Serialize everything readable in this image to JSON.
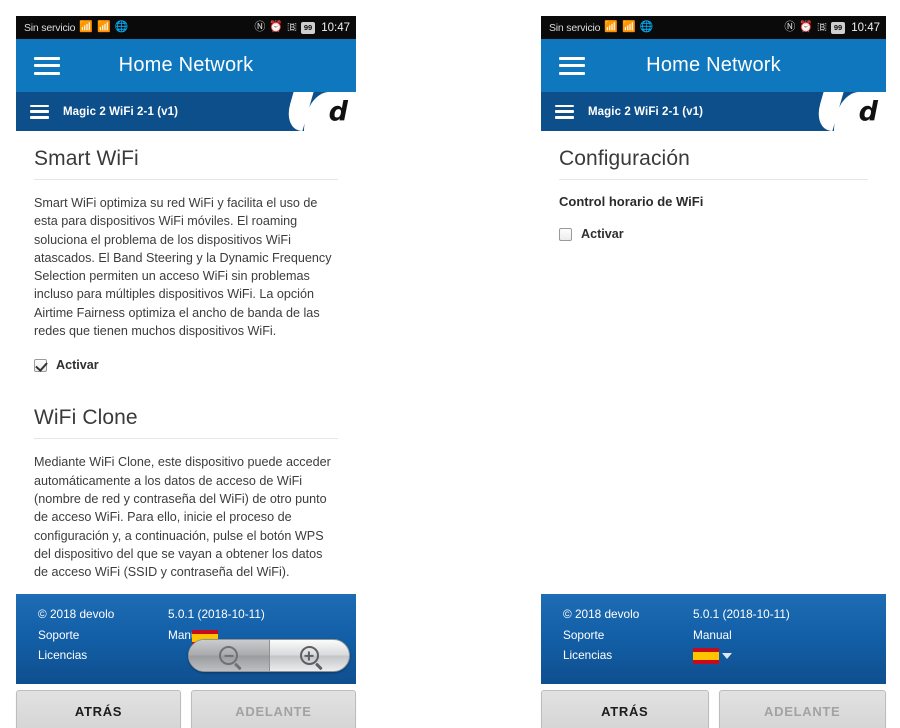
{
  "statusbar": {
    "carrier": "Sin servicio",
    "signal_icon": "signal-bars-icon",
    "wifi_icon": "wifi-icon",
    "data_icon": "globe-data-icon",
    "nfc_icon": "nfc-icon",
    "alarm_icon": "alarm-clock-icon",
    "bluetooth_icon": "bluetooth-icon",
    "battery_level": "99",
    "time": "10:47"
  },
  "header": {
    "menu_icon": "hamburger-menu-icon",
    "title": "Home Network"
  },
  "device_bar": {
    "menu_icon": "hamburger-menu-icon",
    "device_name": "Magic 2 WiFi 2-1 (v1)",
    "brand_logo": "devolo-d-logo",
    "brand_letter": "d"
  },
  "left_panel": {
    "sections": [
      {
        "heading": "Smart WiFi",
        "body": "Smart WiFi optimiza su red WiFi y facilita el uso de esta para dispositivos WiFi móviles. El roaming soluciona el problema de los dispositivos WiFi atascados. El Band Steering y la Dynamic Frequency Selection permiten un acceso WiFi sin problemas incluso para múltiples dispositivos WiFi. La opción Airtime Fairness optimiza el ancho de banda de las redes que tienen muchos dispositivos WiFi.",
        "checkbox_label": "Activar",
        "checked": true
      },
      {
        "heading": "WiFi Clone",
        "body": "Mediante WiFi Clone, este dispositivo puede acceder automáticamente a los datos de acceso de WiFi (nombre de red y contraseña del WiFi) de otro punto de acceso WiFi. Para ello, inicie el proceso de configuración y, a continuación, pulse el botón WPS del dispositivo del que se vayan a obtener los datos de acceso WiFi (SSID y contraseña del WiFi)."
      }
    ]
  },
  "right_panel": {
    "heading": "Configuración",
    "field_label": "Control horario de WiFi",
    "checkbox_label": "Activar",
    "checked": false
  },
  "footer": {
    "copyright": "© 2018   devolo",
    "version": "5.0.1 (2018-10-11)",
    "support_label": "Soporte",
    "manual_label": "Manual",
    "licenses_label": "Licencias",
    "language_flag": "spain-flag-icon",
    "language_caret": "chevron-down-icon",
    "zoom_out_icon": "zoom-out-magnifier-icon",
    "zoom_in_icon": "zoom-in-magnifier-icon"
  },
  "navbar": {
    "back_label": "ATRÁS",
    "forward_label": "ADELANTE",
    "forward_disabled": true
  },
  "colors": {
    "header_blue": "#0f77bd",
    "device_bar_blue": "#0d4f8b",
    "footer_blue": "#1360a8",
    "status_bar": "#0a0a0a",
    "flag_red": "#c60b1e",
    "flag_yellow": "#ffc400"
  }
}
